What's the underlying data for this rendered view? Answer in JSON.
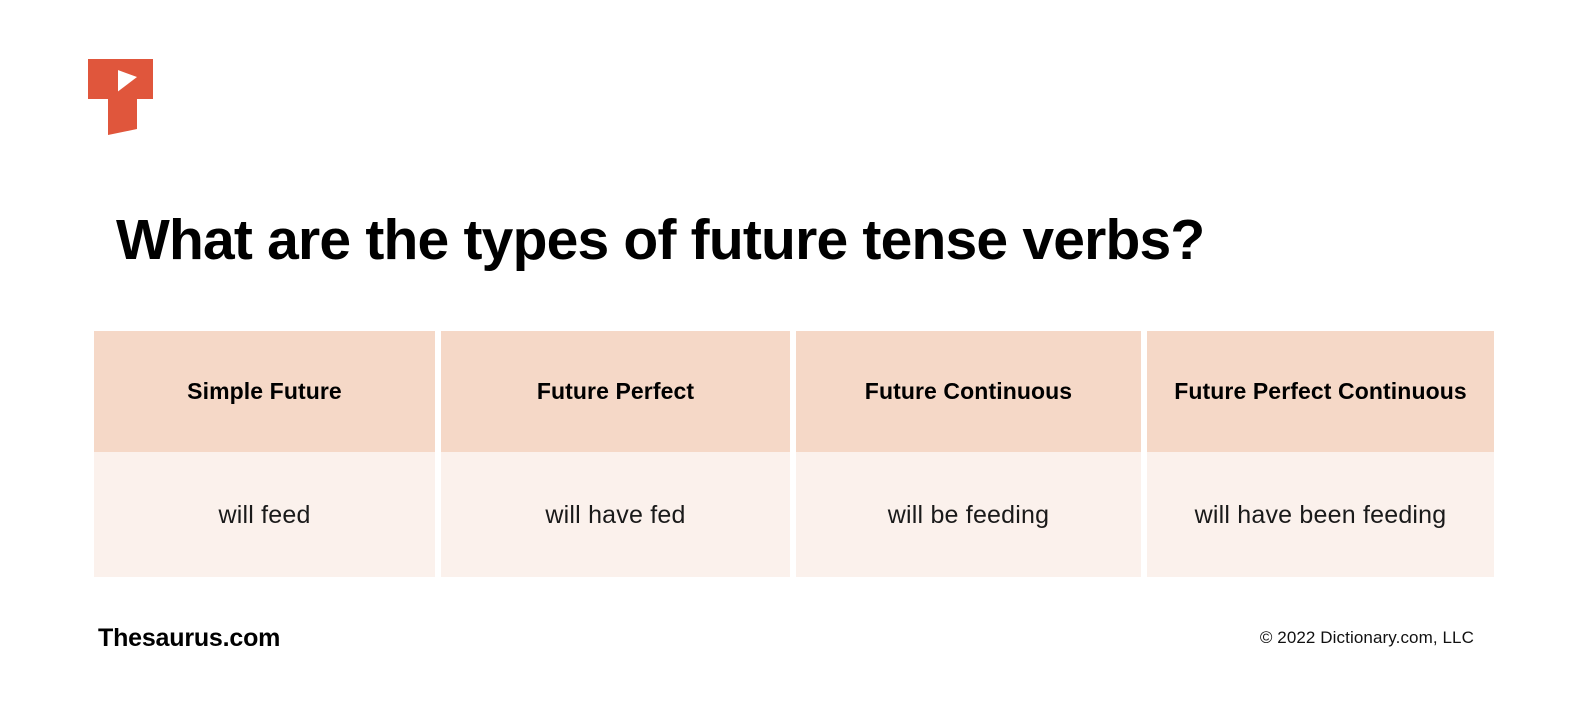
{
  "brand": {
    "logo_icon": "thesaurus-t-logo-icon",
    "logo_color": "#e0563c",
    "footer_name": "Thesaurus.com",
    "copyright": "© 2022 Dictionary.com, LLC"
  },
  "heading": {
    "title": "What are the types of future tense verbs?"
  },
  "theme": {
    "header_cell_bg": "#f5d8c7",
    "body_cell_bg": "#fbf1ec",
    "page_bg": "#ffffff",
    "text_color": "#000000",
    "accent": "#e0563c"
  },
  "table": {
    "columns": [
      {
        "header": "Simple Future",
        "value": "will feed"
      },
      {
        "header": "Future Perfect",
        "value": "will have fed"
      },
      {
        "header": "Future Continuous",
        "value": "will be feeding"
      },
      {
        "header": "Future Perfect Continuous",
        "value": "will have been feeding"
      }
    ]
  }
}
